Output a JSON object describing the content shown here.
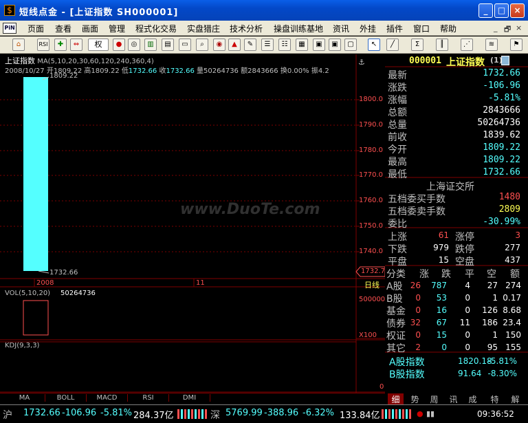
{
  "window": {
    "title": "短线点金 - [上证指数 SH000001]",
    "min": "_",
    "max": "□",
    "close": "×"
  },
  "menu": {
    "logo": "PiN",
    "items": [
      "页面",
      "查看",
      "画面",
      "管理",
      "程式化交易",
      "实盘猎庄",
      "技术分析",
      "操盘训练基地",
      "资讯",
      "外挂",
      "插件",
      "窗口",
      "帮助"
    ],
    "mdi": [
      "_",
      "🗗",
      "×"
    ]
  },
  "toolbar": {
    "rsi": "RSI",
    "quan": "权",
    "icons": [
      "home-icon",
      "rsi-icon",
      "cross-icon",
      "arrows-icon",
      "quan-select",
      "balls-icon",
      "eyes-icon",
      "chart-icon",
      "building-icon",
      "book-icon",
      "search-doc-icon",
      "coin-icon",
      "bell-icon",
      "pen-icon",
      "grid1-icon",
      "grid2-icon",
      "grid3-icon",
      "window1-icon",
      "window2-icon",
      "window3-icon",
      "cursor-icon",
      "line-icon",
      "sigma-icon",
      "bars-icon",
      "fan-icon",
      "channel-icon",
      "flag-icon"
    ]
  },
  "chart": {
    "header1": {
      "name": "上证指数",
      "ma": "MA(5,10,20,30,60,120,240,360,4)"
    },
    "header2": {
      "date": "2008/10/27",
      "open_lbl": "开",
      "open": "1809.22",
      "high_lbl": "高",
      "high": "1809.22",
      "low_lbl": "低",
      "low": "1732.66",
      "close_lbl": "收",
      "close": "1732.66",
      "vol_lbl": "量",
      "vol": "50264736",
      "amt_lbl": "额",
      "amt": "2843666",
      "turn_lbl": "换",
      "turn": "0.00%",
      "amp_lbl": "振",
      "amp": "4.2"
    },
    "candle_high_label": "1809.22",
    "candle_low_label": "1732.66",
    "price_axis": [
      "1800.0",
      "1790.0",
      "1780.0",
      "1770.0",
      "1760.0",
      "1750.0",
      "1740.0"
    ],
    "current_price_tag": "1732.7",
    "x_labels": [
      "2008",
      "11"
    ],
    "period": "日线",
    "vol_header": "VOL(5,10,20)",
    "vol_value": "50264736",
    "vol_axis": [
      "500000",
      "X100"
    ],
    "kdj_header": "KDJ(9,3,3)",
    "kdj_axis": "0",
    "bottom_tabs": [
      "MA",
      "BOLL",
      "MACD",
      "RSI",
      "DMI"
    ],
    "watermark": "www.DuoTe.com"
  },
  "quote": {
    "code": "000001",
    "name": "上证指数",
    "badge": "(1)",
    "rows": [
      {
        "label": "最新",
        "value": "1732.66",
        "color": "#54ffff"
      },
      {
        "label": "涨跌",
        "value": "-106.96",
        "color": "#54ffff"
      },
      {
        "label": "涨幅",
        "value": "-5.81%",
        "color": "#54ffff"
      },
      {
        "label": "总额",
        "value": "2843666",
        "color": "#ffffff"
      },
      {
        "label": "总量",
        "value": "50264736",
        "color": "#ffffff"
      },
      {
        "label": "前收",
        "value": "1839.62",
        "color": "#ffffff"
      },
      {
        "label": "今开",
        "value": "1809.22",
        "color": "#54ffff"
      },
      {
        "label": "最高",
        "value": "1809.22",
        "color": "#54ffff"
      },
      {
        "label": "最低",
        "value": "1732.66",
        "color": "#54ffff"
      }
    ],
    "exchange": "上海证交所",
    "five_buy_lbl": "五档委买手数",
    "five_buy": "1480",
    "five_sell_lbl": "五档委卖手数",
    "five_sell": "2809",
    "weibi_lbl": "委比",
    "weibi": "-30.99%",
    "updown": [
      {
        "l1": "上涨",
        "v1": "61",
        "l2": "涨停",
        "v2": "3"
      },
      {
        "l1": "下跌",
        "v1": "979",
        "l2": "跌停",
        "v2": "277"
      },
      {
        "l1": "平盘",
        "v1": "15",
        "l2": "空盘",
        "v2": "437"
      }
    ],
    "class_header": [
      "分类",
      "涨",
      "跌",
      "平",
      "空",
      "额"
    ],
    "class_rows": [
      {
        "name": "A股",
        "up": "26",
        "down": "787",
        "flat": "4",
        "empty": "27",
        "amt": "274"
      },
      {
        "name": "B股",
        "up": "0",
        "down": "53",
        "flat": "0",
        "empty": "1",
        "amt": "0.17"
      },
      {
        "name": "基金",
        "up": "0",
        "down": "16",
        "flat": "0",
        "empty": "126",
        "amt": "8.68"
      },
      {
        "name": "债券",
        "up": "32",
        "down": "67",
        "flat": "11",
        "empty": "186",
        "amt": "23.4"
      },
      {
        "name": "权证",
        "up": "0",
        "down": "15",
        "flat": "0",
        "empty": "1",
        "amt": "150"
      },
      {
        "name": "其它",
        "up": "2",
        "down": "0",
        "flat": "0",
        "empty": "95",
        "amt": "155"
      }
    ],
    "index_rows": [
      {
        "name": "A股指数",
        "value": "1820.18",
        "pct": "-5.81%"
      },
      {
        "name": "B股指数",
        "value": "91.64",
        "pct": "-8.30%"
      }
    ],
    "tabs": [
      "细",
      "势",
      "周",
      "讯",
      "成",
      "特",
      "解"
    ],
    "active_tab": "细"
  },
  "status": {
    "sh_lbl": "沪",
    "sh_price": "1732.66",
    "sh_chg": "-106.96",
    "sh_pct": "-5.81%",
    "sh_amt": "284.37亿",
    "sz_lbl": "深",
    "sz_price": "5769.99",
    "sz_chg": "-388.96",
    "sz_pct": "-6.32%",
    "sz_amt": "133.84亿",
    "time": "09:36:52"
  },
  "colors": {
    "up": "#ff5050",
    "down": "#54ffff",
    "grid": "#800000",
    "label": "#c0c0c0",
    "accent": "#ffff54"
  }
}
